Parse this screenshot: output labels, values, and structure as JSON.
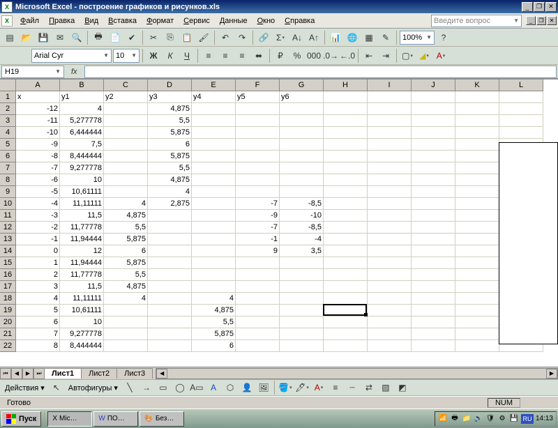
{
  "title": "Microsoft Excel - построение графиков и рисунков.xls",
  "menu": [
    "Файл",
    "Правка",
    "Вид",
    "Вставка",
    "Формат",
    "Сервис",
    "Данные",
    "Окно",
    "Справка"
  ],
  "question_placeholder": "Введите вопрос",
  "font": {
    "name": "Arial Cyr",
    "size": "10"
  },
  "zoom": "100%",
  "namebox": "H19",
  "bold": "Ж",
  "italic": "К",
  "underline": "Ч",
  "columns": [
    "A",
    "B",
    "C",
    "D",
    "E",
    "F",
    "G",
    "H",
    "I",
    "J",
    "K",
    "L"
  ],
  "rows": [
    {
      "n": "1",
      "c": [
        "x",
        "y1",
        "y2",
        "y3",
        "y4",
        "y5",
        "y6",
        "",
        "",
        "",
        "",
        ""
      ],
      "t": [
        "txt",
        "txt",
        "txt",
        "txt",
        "txt",
        "txt",
        "txt",
        "",
        "",
        "",
        "",
        ""
      ]
    },
    {
      "n": "2",
      "c": [
        "-12",
        "4",
        "",
        "4,875",
        "",
        "",
        "",
        "",
        "",
        "",
        "",
        ""
      ],
      "t": [
        "num",
        "num",
        "",
        "num",
        "",
        "",
        "",
        "",
        "",
        "",
        "",
        ""
      ]
    },
    {
      "n": "3",
      "c": [
        "-11",
        "5,277778",
        "",
        "5,5",
        "",
        "",
        "",
        "",
        "",
        "",
        "",
        ""
      ],
      "t": [
        "num",
        "num",
        "",
        "num",
        "",
        "",
        "",
        "",
        "",
        "",
        "",
        ""
      ]
    },
    {
      "n": "4",
      "c": [
        "-10",
        "6,444444",
        "",
        "5,875",
        "",
        "",
        "",
        "",
        "",
        "",
        "",
        ""
      ],
      "t": [
        "num",
        "num",
        "",
        "num",
        "",
        "",
        "",
        "",
        "",
        "",
        "",
        ""
      ]
    },
    {
      "n": "5",
      "c": [
        "-9",
        "7,5",
        "",
        "6",
        "",
        "",
        "",
        "",
        "",
        "",
        "",
        ""
      ],
      "t": [
        "num",
        "num",
        "",
        "num",
        "",
        "",
        "",
        "",
        "",
        "",
        "",
        ""
      ]
    },
    {
      "n": "6",
      "c": [
        "-8",
        "8,444444",
        "",
        "5,875",
        "",
        "",
        "",
        "",
        "",
        "",
        "",
        ""
      ],
      "t": [
        "num",
        "num",
        "",
        "num",
        "",
        "",
        "",
        "",
        "",
        "",
        "",
        ""
      ]
    },
    {
      "n": "7",
      "c": [
        "-7",
        "9,277778",
        "",
        "5,5",
        "",
        "",
        "",
        "",
        "",
        "",
        "",
        ""
      ],
      "t": [
        "num",
        "num",
        "",
        "num",
        "",
        "",
        "",
        "",
        "",
        "",
        "",
        ""
      ]
    },
    {
      "n": "8",
      "c": [
        "-6",
        "10",
        "",
        "4,875",
        "",
        "",
        "",
        "",
        "",
        "",
        "",
        ""
      ],
      "t": [
        "num",
        "num",
        "",
        "num",
        "",
        "",
        "",
        "",
        "",
        "",
        "",
        ""
      ]
    },
    {
      "n": "9",
      "c": [
        "-5",
        "10,61111",
        "",
        "4",
        "",
        "",
        "",
        "",
        "",
        "",
        "",
        ""
      ],
      "t": [
        "num",
        "num",
        "",
        "num",
        "",
        "",
        "",
        "",
        "",
        "",
        "",
        ""
      ]
    },
    {
      "n": "10",
      "c": [
        "-4",
        "11,11111",
        "4",
        "2,875",
        "",
        "-7",
        "-8,5",
        "",
        "",
        "",
        "",
        ""
      ],
      "t": [
        "num",
        "num",
        "num",
        "num",
        "",
        "num",
        "num",
        "",
        "",
        "",
        "",
        ""
      ]
    },
    {
      "n": "11",
      "c": [
        "-3",
        "11,5",
        "4,875",
        "",
        "",
        "-9",
        "-10",
        "",
        "",
        "",
        "",
        ""
      ],
      "t": [
        "num",
        "num",
        "num",
        "",
        "",
        "num",
        "num",
        "",
        "",
        "",
        "",
        ""
      ]
    },
    {
      "n": "12",
      "c": [
        "-2",
        "11,77778",
        "5,5",
        "",
        "",
        "-7",
        "-8,5",
        "",
        "",
        "",
        "",
        ""
      ],
      "t": [
        "num",
        "num",
        "num",
        "",
        "",
        "num",
        "num",
        "",
        "",
        "",
        "",
        ""
      ]
    },
    {
      "n": "13",
      "c": [
        "-1",
        "11,94444",
        "5,875",
        "",
        "",
        "-1",
        "-4",
        "",
        "",
        "",
        "",
        ""
      ],
      "t": [
        "num",
        "num",
        "num",
        "",
        "",
        "num",
        "num",
        "",
        "",
        "",
        "",
        ""
      ]
    },
    {
      "n": "14",
      "c": [
        "0",
        "12",
        "6",
        "",
        "",
        "9",
        "3,5",
        "",
        "",
        "",
        "",
        ""
      ],
      "t": [
        "num",
        "num",
        "num",
        "",
        "",
        "num",
        "num",
        "",
        "",
        "",
        "",
        ""
      ]
    },
    {
      "n": "15",
      "c": [
        "1",
        "11,94444",
        "5,875",
        "",
        "",
        "",
        "",
        "",
        "",
        "",
        "",
        ""
      ],
      "t": [
        "num",
        "num",
        "num",
        "",
        "",
        "",
        "",
        "",
        "",
        "",
        "",
        ""
      ]
    },
    {
      "n": "16",
      "c": [
        "2",
        "11,77778",
        "5,5",
        "",
        "",
        "",
        "",
        "",
        "",
        "",
        "",
        ""
      ],
      "t": [
        "num",
        "num",
        "num",
        "",
        "",
        "",
        "",
        "",
        "",
        "",
        "",
        ""
      ]
    },
    {
      "n": "17",
      "c": [
        "3",
        "11,5",
        "4,875",
        "",
        "",
        "",
        "",
        "",
        "",
        "",
        "",
        ""
      ],
      "t": [
        "num",
        "num",
        "num",
        "",
        "",
        "",
        "",
        "",
        "",
        "",
        "",
        ""
      ]
    },
    {
      "n": "18",
      "c": [
        "4",
        "11,11111",
        "4",
        "",
        "4",
        "",
        "",
        "",
        "",
        "",
        "",
        ""
      ],
      "t": [
        "num",
        "num",
        "num",
        "",
        "num",
        "",
        "",
        "",
        "",
        "",
        "",
        ""
      ]
    },
    {
      "n": "19",
      "c": [
        "5",
        "10,61111",
        "",
        "",
        "4,875",
        "",
        "",
        "",
        "",
        "",
        "",
        ""
      ],
      "t": [
        "num",
        "num",
        "",
        "",
        "num",
        "",
        "",
        "",
        "",
        "",
        "",
        ""
      ]
    },
    {
      "n": "20",
      "c": [
        "6",
        "10",
        "",
        "",
        "5,5",
        "",
        "",
        "",
        "",
        "",
        "",
        ""
      ],
      "t": [
        "num",
        "num",
        "",
        "",
        "num",
        "",
        "",
        "",
        "",
        "",
        "",
        ""
      ]
    },
    {
      "n": "21",
      "c": [
        "7",
        "9,277778",
        "",
        "",
        "5,875",
        "",
        "",
        "",
        "",
        "",
        "",
        ""
      ],
      "t": [
        "num",
        "num",
        "",
        "",
        "num",
        "",
        "",
        "",
        "",
        "",
        "",
        ""
      ]
    },
    {
      "n": "22",
      "c": [
        "8",
        "8,444444",
        "",
        "",
        "6",
        "",
        "",
        "",
        "",
        "",
        "",
        ""
      ],
      "t": [
        "num",
        "num",
        "",
        "",
        "num",
        "",
        "",
        "",
        "",
        "",
        "",
        ""
      ]
    }
  ],
  "active_cell": {
    "row": 19,
    "col": 8
  },
  "sheets": [
    "Лист1",
    "Лист2",
    "Лист3"
  ],
  "draw": {
    "actions": "Действия",
    "autoshapes": "Автофигуры"
  },
  "status": {
    "ready": "Готово",
    "num": "NUM"
  },
  "task": {
    "start": "Пуск",
    "apps": [
      "Mic…",
      "ПО…",
      "Без…"
    ]
  },
  "tray": {
    "lang": "RU",
    "clock": "14:13"
  }
}
